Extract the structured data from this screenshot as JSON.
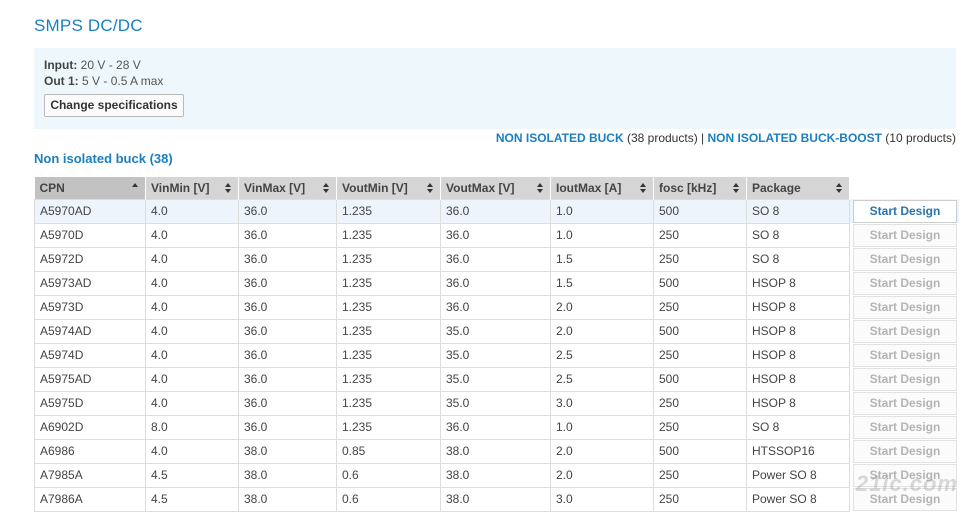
{
  "page": {
    "title": "SMPS DC/DC"
  },
  "specs": {
    "input_label": "Input:",
    "input_value": "20 V - 28 V",
    "out_label": "Out 1:",
    "out_value": "5 V - 0.5 A max",
    "change_button": "Change specifications"
  },
  "categories": {
    "buck_link": "NON ISOLATED BUCK",
    "buck_count": "(38 products)",
    "separator": "|",
    "buckboost_link": "NON ISOLATED BUCK-BOOST",
    "buckboost_count": "(10 products)"
  },
  "section_title": "Non isolated buck (38)",
  "table": {
    "columns": [
      "CPN",
      "VinMin [V]",
      "VinMax [V]",
      "VoutMin [V]",
      "VoutMax [V]",
      "IoutMax [A]",
      "fosc [kHz]",
      "Package"
    ],
    "sorted_column": "CPN",
    "action_label": "Start Design",
    "rows": [
      [
        "A5970AD",
        "4.0",
        "36.0",
        "1.235",
        "36.0",
        "1.0",
        "500",
        "SO 8"
      ],
      [
        "A5970D",
        "4.0",
        "36.0",
        "1.235",
        "36.0",
        "1.0",
        "250",
        "SO 8"
      ],
      [
        "A5972D",
        "4.0",
        "36.0",
        "1.235",
        "36.0",
        "1.5",
        "250",
        "SO 8"
      ],
      [
        "A5973AD",
        "4.0",
        "36.0",
        "1.235",
        "36.0",
        "1.5",
        "500",
        "HSOP 8"
      ],
      [
        "A5973D",
        "4.0",
        "36.0",
        "1.235",
        "36.0",
        "2.0",
        "250",
        "HSOP 8"
      ],
      [
        "A5974AD",
        "4.0",
        "36.0",
        "1.235",
        "35.0",
        "2.0",
        "500",
        "HSOP 8"
      ],
      [
        "A5974D",
        "4.0",
        "36.0",
        "1.235",
        "35.0",
        "2.5",
        "250",
        "HSOP 8"
      ],
      [
        "A5975AD",
        "4.0",
        "36.0",
        "1.235",
        "35.0",
        "2.5",
        "500",
        "HSOP 8"
      ],
      [
        "A5975D",
        "4.0",
        "36.0",
        "1.235",
        "35.0",
        "3.0",
        "250",
        "HSOP 8"
      ],
      [
        "A6902D",
        "8.0",
        "36.0",
        "1.235",
        "36.0",
        "1.0",
        "250",
        "SO 8"
      ],
      [
        "A6986",
        "4.0",
        "38.0",
        "0.85",
        "38.0",
        "2.0",
        "500",
        "HTSSOP16"
      ],
      [
        "A7985A",
        "4.5",
        "38.0",
        "0.6",
        "38.0",
        "2.0",
        "250",
        "Power SO 8"
      ],
      [
        "A7986A",
        "4.5",
        "38.0",
        "0.6",
        "38.0",
        "3.0",
        "250",
        "Power SO 8"
      ]
    ]
  },
  "watermark": "21ic.com",
  "colors": {
    "accent": "#1a7fc0",
    "spec_bg": "#eef7fc",
    "header_bg": "#d5d5d5",
    "highlight_row": "#eef4fb"
  }
}
